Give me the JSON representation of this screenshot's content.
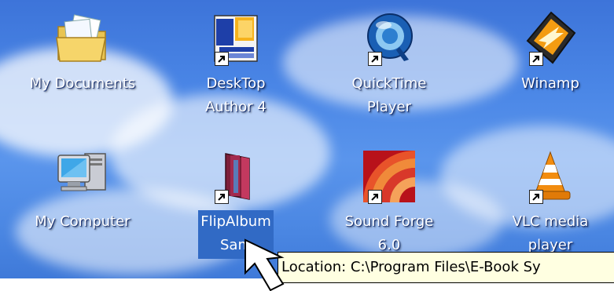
{
  "desktop": {
    "icons": [
      {
        "label": "My Documents",
        "icon": "folder-documents-icon",
        "shortcut": false
      },
      {
        "label": "DeskTop\nAuthor 4",
        "icon": "desktop-author-icon",
        "shortcut": true
      },
      {
        "label": "QuickTime\nPlayer",
        "icon": "quicktime-icon",
        "shortcut": true
      },
      {
        "label": "Winamp",
        "icon": "winamp-icon",
        "shortcut": true
      },
      {
        "label": "My Computer",
        "icon": "computer-icon",
        "shortcut": false
      },
      {
        "label": "FlipAlbum\nSam",
        "icon": "flipalbum-book-icon",
        "shortcut": true,
        "selected": true
      },
      {
        "label": "Sound Forge\n6.0",
        "icon": "sound-forge-icon",
        "shortcut": true
      },
      {
        "label": "VLC media\nplayer",
        "icon": "vlc-cone-icon",
        "shortcut": true
      }
    ],
    "tooltip": "Location: C:\\Program Files\\E-Book Sy",
    "colors": {
      "sky": "#4a86e6",
      "selection": "#316ac5",
      "tooltip_bg": "#ffffe1"
    }
  }
}
